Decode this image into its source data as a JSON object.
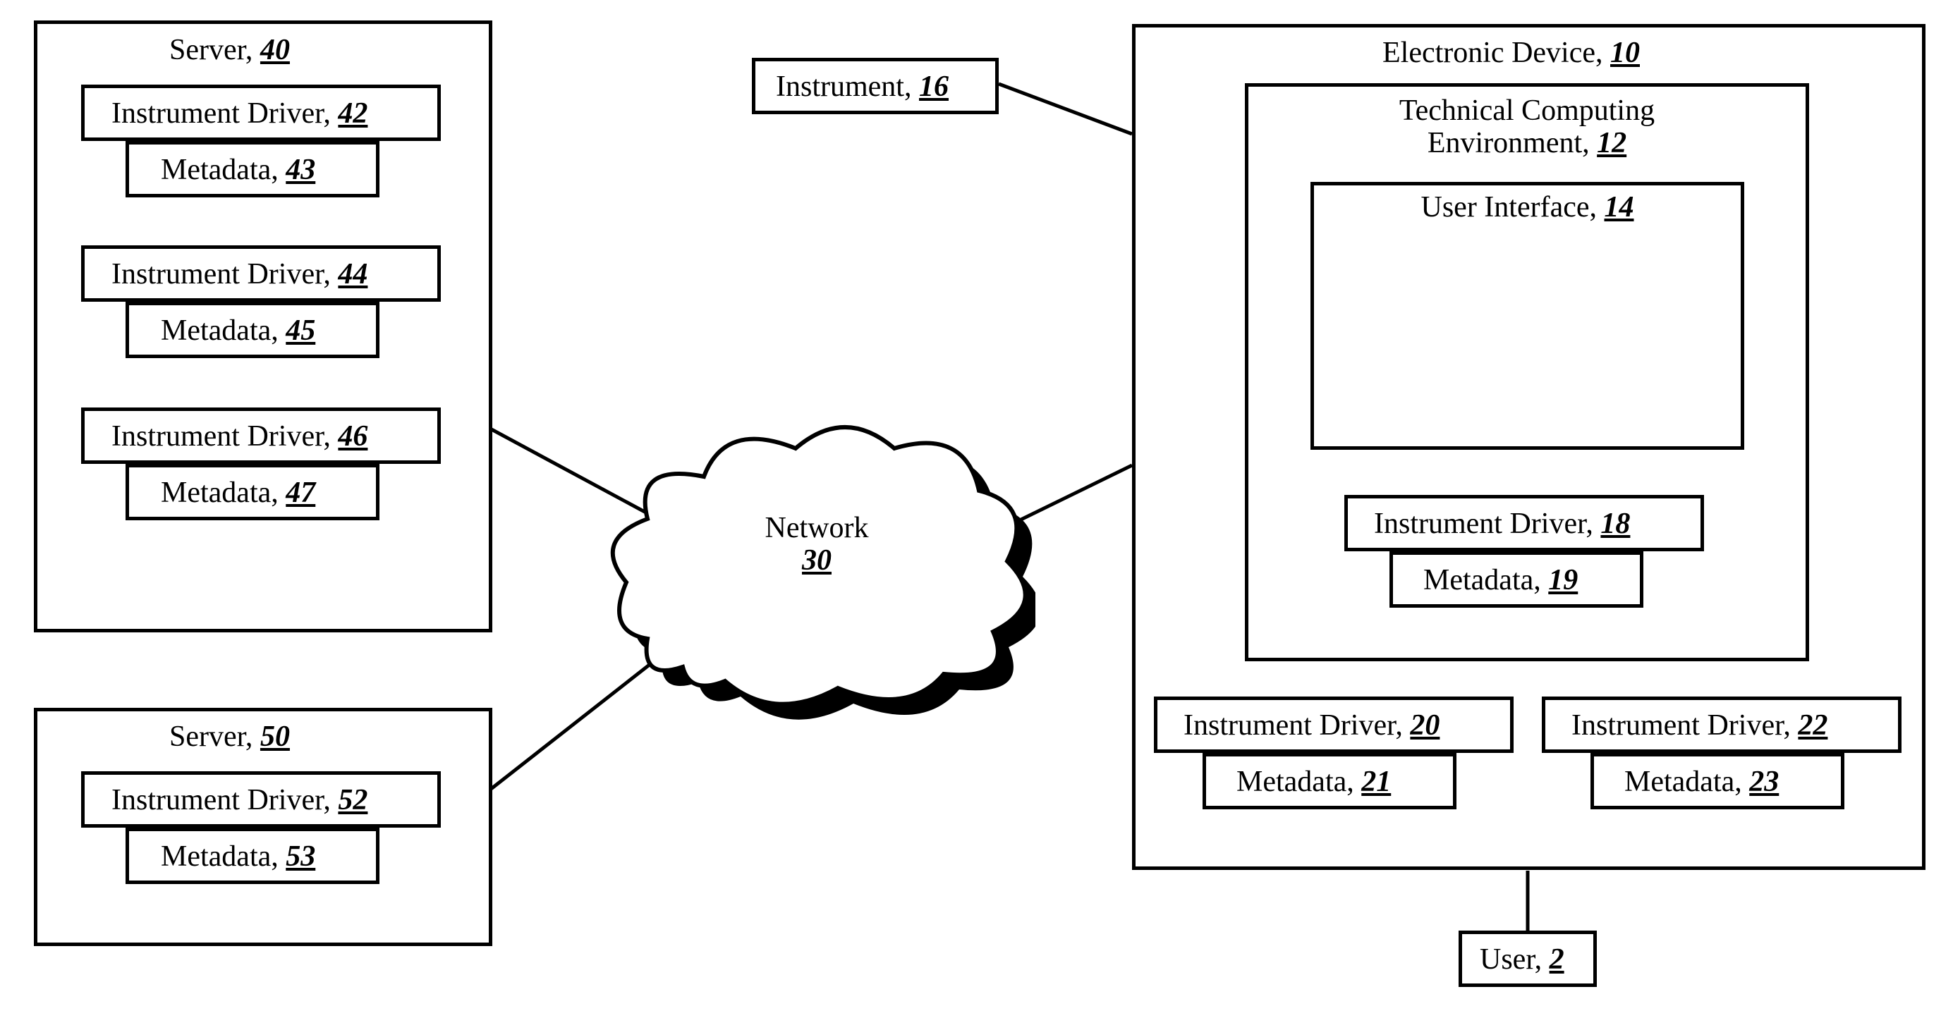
{
  "server40": {
    "title_label": "Server, ",
    "title_ref": "40"
  },
  "driver42": {
    "label": "Instrument Driver, ",
    "ref": "42"
  },
  "meta43": {
    "label": "Metadata, ",
    "ref": "43"
  },
  "driver44": {
    "label": "Instrument Driver, ",
    "ref": "44"
  },
  "meta45": {
    "label": "Metadata, ",
    "ref": "45"
  },
  "driver46": {
    "label": "Instrument Driver, ",
    "ref": "46"
  },
  "meta47": {
    "label": "Metadata, ",
    "ref": "47"
  },
  "server50": {
    "title_label": "Server, ",
    "title_ref": "50"
  },
  "driver52": {
    "label": "Instrument Driver, ",
    "ref": "52"
  },
  "meta53": {
    "label": "Metadata, ",
    "ref": "53"
  },
  "network": {
    "label": "Network",
    "ref": "30"
  },
  "instrument16": {
    "label": "Instrument, ",
    "ref": "16"
  },
  "device10": {
    "title_label": "Electronic Device, ",
    "title_ref": "10"
  },
  "tce12": {
    "line1": "Technical Computing",
    "line2_label": "Environment, ",
    "line2_ref": "12"
  },
  "ui14": {
    "label": "User Interface, ",
    "ref": "14"
  },
  "driver18": {
    "label": "Instrument Driver, ",
    "ref": "18"
  },
  "meta19": {
    "label": "Metadata, ",
    "ref": "19"
  },
  "driver20": {
    "label": "Instrument Driver, ",
    "ref": "20"
  },
  "meta21": {
    "label": "Metadata, ",
    "ref": "21"
  },
  "driver22": {
    "label": "Instrument Driver, ",
    "ref": "22"
  },
  "meta23": {
    "label": "Metadata, ",
    "ref": "23"
  },
  "user2": {
    "label": "User, ",
    "ref": "2"
  }
}
